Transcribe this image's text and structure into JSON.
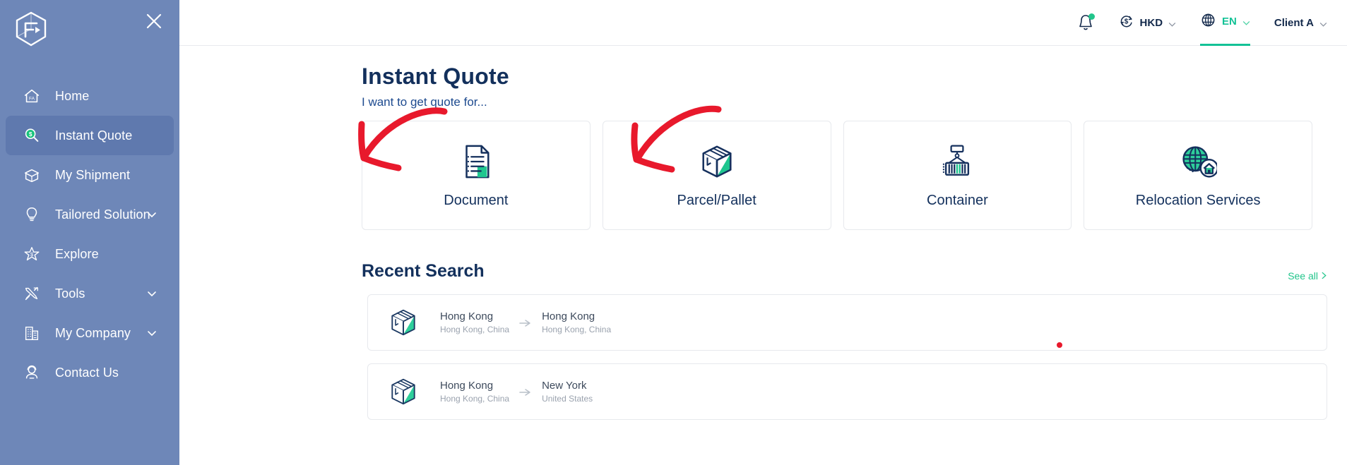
{
  "sidebar": {
    "logo_name": "fa-logo",
    "close_label": "×",
    "items": [
      {
        "label": "Home",
        "icon": "home-icon",
        "active": false,
        "expandable": false
      },
      {
        "label": "Instant Quote",
        "icon": "instant-quote-icon",
        "active": true,
        "expandable": false
      },
      {
        "label": "My Shipment",
        "icon": "shipment-box-icon",
        "active": false,
        "expandable": false
      },
      {
        "label": "Tailored Solution",
        "icon": "lightbulb-icon",
        "active": false,
        "expandable": true
      },
      {
        "label": "Explore",
        "icon": "star-dollar-icon",
        "active": false,
        "expandable": false
      },
      {
        "label": "Tools",
        "icon": "tools-icon",
        "active": false,
        "expandable": true
      },
      {
        "label": "My Company",
        "icon": "building-icon",
        "active": false,
        "expandable": true
      },
      {
        "label": "Contact Us",
        "icon": "headset-agent-icon",
        "active": false,
        "expandable": false
      }
    ]
  },
  "topbar": {
    "notification_icon": "bell-icon",
    "currency": "HKD",
    "currency_icon": "dollar-refresh-icon",
    "language": "EN",
    "language_icon": "globe-icon",
    "account": "Client A"
  },
  "main": {
    "title": "Instant Quote",
    "subtitle": "I want to get quote for...",
    "cards": [
      {
        "label": "Document",
        "icon": "document-icon"
      },
      {
        "label": "Parcel/Pallet",
        "icon": "parcel-box-icon"
      },
      {
        "label": "Container",
        "icon": "container-crane-icon"
      },
      {
        "label": "Relocation Services",
        "icon": "globe-house-icon"
      }
    ],
    "recent": {
      "title": "Recent Search",
      "see_all": "See all",
      "rows": [
        {
          "icon": "parcel-box-icon",
          "origin": "Hong Kong",
          "origin_sub": "Hong Kong, China",
          "destination": "Hong Kong",
          "destination_sub": "Hong Kong, China"
        },
        {
          "icon": "parcel-box-icon",
          "origin": "Hong Kong",
          "origin_sub": "Hong Kong, China",
          "destination": "New York",
          "destination_sub": "United States"
        }
      ]
    }
  },
  "colors": {
    "sidebar_bg": "#6e87b8",
    "sidebar_active": "#5f79ae",
    "navy": "#13305c",
    "green": "#22c58b",
    "annotation_red": "#e8192c"
  }
}
